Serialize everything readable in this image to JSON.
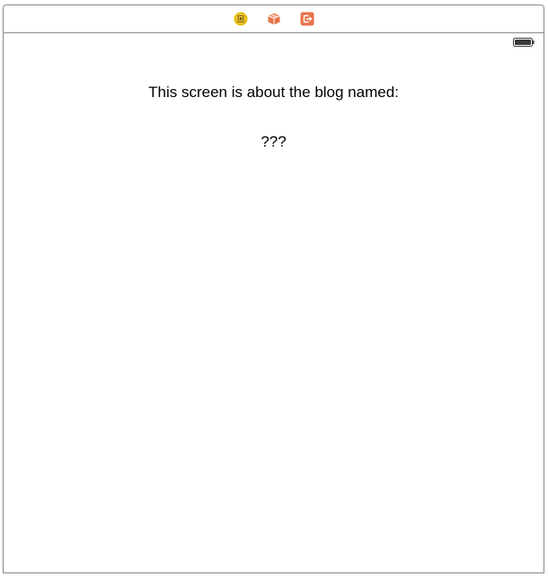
{
  "scene": {
    "dock_icons": [
      {
        "name": "view-controller-icon",
        "color": "#f2c200"
      },
      {
        "name": "first-responder-icon",
        "color": "#e8734a"
      },
      {
        "name": "exit-icon",
        "color": "#e8734a"
      }
    ],
    "status_bar": {
      "battery_icon": "battery-icon"
    }
  },
  "view": {
    "title_label": "This screen is about the blog named:",
    "name_label": "???"
  },
  "colors": {
    "frame_border": "#8a8a8a",
    "text": "#000000",
    "background": "#ffffff"
  }
}
